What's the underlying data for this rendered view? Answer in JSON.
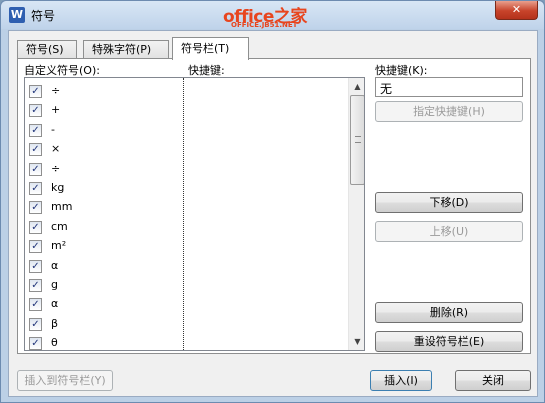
{
  "window": {
    "icon_letter": "W",
    "title": "符号",
    "close_glyph": "✕",
    "watermark": {
      "main": "office之家",
      "sub": "OFFICE.JB51.NET"
    }
  },
  "tabs": [
    {
      "label": "符号(S)",
      "active": false
    },
    {
      "label": "特殊字符(P)",
      "active": false
    },
    {
      "label": "符号栏(T)",
      "active": true
    }
  ],
  "panel": {
    "custom_symbols_label": "自定义符号(O):",
    "shortcut_column_label": "快捷键:",
    "shortcut_field_label": "快捷键(K):",
    "shortcut_value": "无",
    "assign_shortcut_label": "指定快捷键(H)",
    "move_down_label": "下移(D)",
    "move_up_label": "上移(U)",
    "delete_label": "删除(R)",
    "reset_label": "重设符号栏(E)",
    "symbols": [
      {
        "symbol": "÷",
        "checked": true
      },
      {
        "symbol": "+",
        "checked": true
      },
      {
        "symbol": "-",
        "checked": true
      },
      {
        "symbol": "×",
        "checked": true
      },
      {
        "symbol": "÷",
        "checked": true
      },
      {
        "symbol": "kg",
        "checked": true
      },
      {
        "symbol": "mm",
        "checked": true
      },
      {
        "symbol": "cm",
        "checked": true
      },
      {
        "symbol": "m²",
        "checked": true
      },
      {
        "symbol": "α",
        "checked": true
      },
      {
        "symbol": "g",
        "checked": true
      },
      {
        "symbol": "α",
        "checked": true
      },
      {
        "symbol": "β",
        "checked": true
      },
      {
        "symbol": "θ",
        "checked": true
      }
    ],
    "check_glyph": "✓",
    "scroll_up_glyph": "▲",
    "scroll_down_glyph": "▼"
  },
  "footer": {
    "insert_to_bar_label": "插入到符号栏(Y)",
    "insert_label": "插入(I)",
    "close_label": "关闭"
  }
}
